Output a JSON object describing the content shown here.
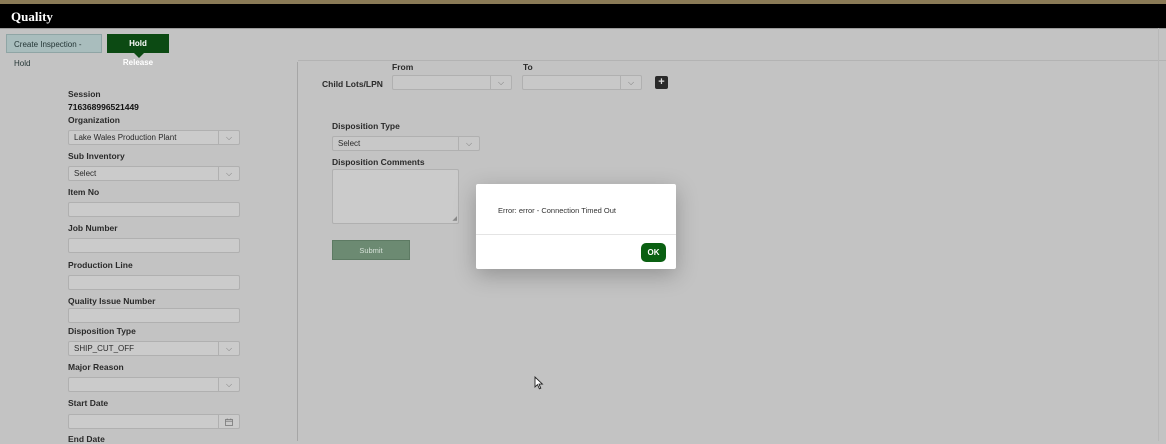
{
  "app": {
    "title": "Quality"
  },
  "tabs": {
    "create": "Create Inspection - Hold",
    "hold": "Hold Release"
  },
  "left": {
    "session_label": "Session",
    "session_value": "716368996521449",
    "organization_label": "Organization",
    "organization_value": "Lake Wales Production Plant",
    "sub_inventory_label": "Sub Inventory",
    "sub_inventory_value": "Select",
    "item_no_label": "Item No",
    "job_number_label": "Job Number",
    "production_line_label": "Production Line",
    "quality_issue_label": "Quality Issue Number",
    "disposition_type_label": "Disposition Type",
    "disposition_type_value": "SHIP_CUT_OFF",
    "major_reason_label": "Major Reason",
    "start_date_label": "Start Date",
    "end_date_label": "End Date"
  },
  "right": {
    "from_label": "From",
    "to_label": "To",
    "child_lots_label": "Child Lots/LPN",
    "disposition_type_label": "Disposition Type",
    "disposition_type_value": "Select",
    "disposition_comments_label": "Disposition Comments",
    "submit_label": "Submit"
  },
  "modal": {
    "message": "Error: error - Connection Timed Out",
    "ok_label": "OK"
  },
  "icons": {
    "caret": "chevron-down-icon",
    "add": "plus-square-icon",
    "calendar": "calendar-icon",
    "cursor": "mouse-pointer-icon"
  },
  "colors": {
    "header_bg": "#000000",
    "active_tab": "#0c4a13",
    "ok_button": "#0a6012"
  }
}
